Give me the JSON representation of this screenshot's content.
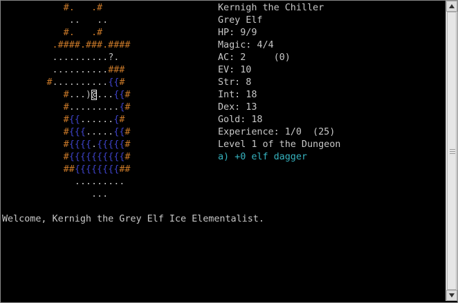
{
  "map": [
    [
      {
        "t": "           #.   .#",
        "c": "orange"
      }
    ],
    [
      {
        "t": "            ..   ..",
        "c": "grey"
      }
    ],
    [
      {
        "t": "           #.   .#",
        "c": "orange"
      }
    ],
    [
      {
        "t": "         .####.###.####",
        "c": "orange"
      }
    ],
    [
      {
        "t": "         ..........",
        "c": "grey"
      },
      {
        "t": "?",
        "c": "grey"
      },
      {
        "t": ".",
        "c": "grey"
      }
    ],
    [
      {
        "t": "         ..........",
        "c": "grey"
      },
      {
        "t": "###",
        "c": "orange"
      }
    ],
    [
      {
        "t": "        #",
        "c": "orange"
      },
      {
        "t": "..........",
        "c": "grey"
      },
      {
        "t": "{{",
        "c": "blue"
      },
      {
        "t": "#",
        "c": "orange"
      }
    ],
    [
      {
        "t": "           #",
        "c": "orange"
      },
      {
        "t": "...)",
        "c": "grey"
      },
      {
        "t": "@",
        "c": "player"
      },
      {
        "t": "...",
        "c": "grey"
      },
      {
        "t": "{{",
        "c": "blue"
      },
      {
        "t": "#",
        "c": "orange"
      }
    ],
    [
      {
        "t": "           #",
        "c": "orange"
      },
      {
        "t": ".........",
        "c": "grey"
      },
      {
        "t": "{",
        "c": "blue"
      },
      {
        "t": "#",
        "c": "orange"
      }
    ],
    [
      {
        "t": "           #",
        "c": "orange"
      },
      {
        "t": "{{",
        "c": "blue"
      },
      {
        "t": "......",
        "c": "grey"
      },
      {
        "t": "{",
        "c": "blue"
      },
      {
        "t": "#",
        "c": "orange"
      }
    ],
    [
      {
        "t": "           #",
        "c": "orange"
      },
      {
        "t": "{{{",
        "c": "blue"
      },
      {
        "t": ".....",
        "c": "grey"
      },
      {
        "t": "{{",
        "c": "blue"
      },
      {
        "t": "#",
        "c": "orange"
      }
    ],
    [
      {
        "t": "           #",
        "c": "orange"
      },
      {
        "t": "{{{{",
        "c": "blue"
      },
      {
        "t": ".",
        "c": "grey"
      },
      {
        "t": "{{{{{",
        "c": "blue"
      },
      {
        "t": "#",
        "c": "orange"
      }
    ],
    [
      {
        "t": "           #",
        "c": "orange"
      },
      {
        "t": "{{{{{{{{{{",
        "c": "blue"
      },
      {
        "t": "#",
        "c": "orange"
      }
    ],
    [
      {
        "t": "           ##",
        "c": "orange"
      },
      {
        "t": "{{{{{{{{",
        "c": "blue"
      },
      {
        "t": "##",
        "c": "orange"
      }
    ],
    [
      {
        "t": "             .........",
        "c": "grey"
      }
    ],
    [
      {
        "t": "                ...",
        "c": "grey"
      }
    ]
  ],
  "stats": {
    "name": "Kernigh the Chiller",
    "species": "Grey Elf",
    "hp": "HP: 9/9",
    "magic": "Magic: 4/4",
    "ac": "AC: 2     (0)",
    "ev": "EV: 10",
    "str": "Str: 8",
    "int": "Int: 18",
    "dex": "Dex: 13",
    "gold": "Gold: 18",
    "experience": "Experience: 1/0  (25)",
    "level": "Level 1 of the Dungeon",
    "weapon": "a) +0 elf dagger"
  },
  "message": "Welcome, Kernigh the Grey Elf Ice Elementalist.",
  "colors": {
    "wall": "#c87828",
    "floor": "#bdbdbd",
    "water": "#3e43c8",
    "weapon": "#36b4c0"
  }
}
